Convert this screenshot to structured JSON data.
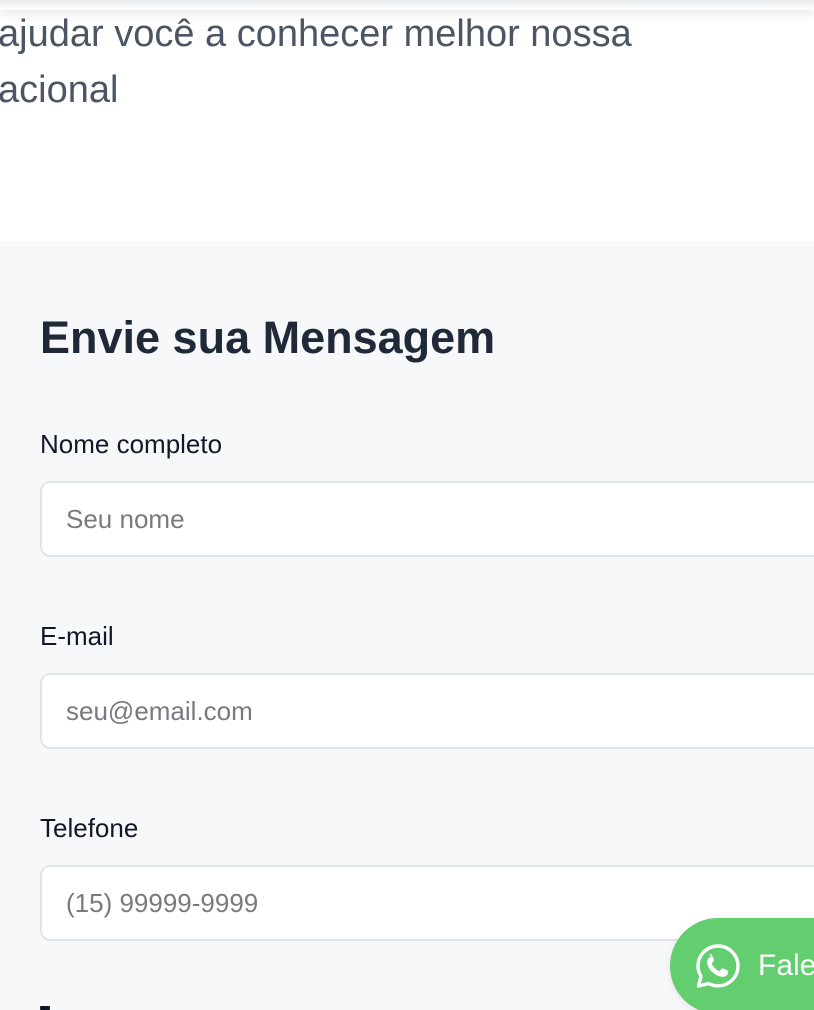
{
  "intro": {
    "line1": "ajudar você a conhecer melhor nossa",
    "line2": "acional"
  },
  "form": {
    "title": "Envie sua Mensagem",
    "fields": [
      {
        "label": "Nome completo",
        "placeholder": "Seu nome"
      },
      {
        "label": "E-mail",
        "placeholder": "seu@email.com"
      },
      {
        "label": "Telefone",
        "placeholder": "(15) 99999-9999"
      }
    ]
  },
  "whatsapp": {
    "label": "Fale",
    "icon": "whatsapp-icon",
    "color": "#62ce6f"
  }
}
